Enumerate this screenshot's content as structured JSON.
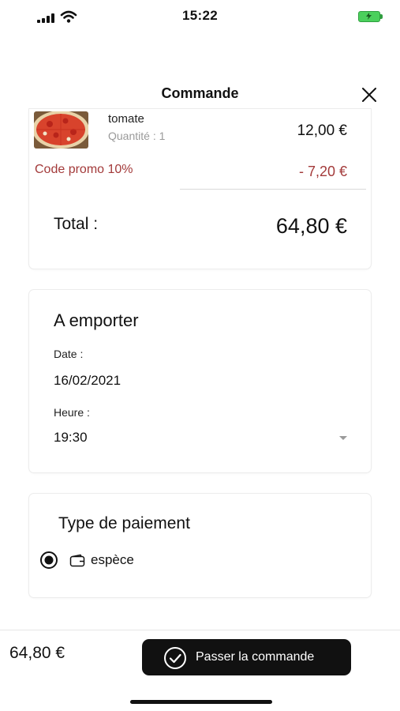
{
  "status_bar": {
    "time": "15:22"
  },
  "header": {
    "title": "Commande",
    "close_icon": "close-icon"
  },
  "order": {
    "item_name": "tomate",
    "item_quantity": "Quantité : 1",
    "item_price": "12,00 €",
    "promo_label": "Code promo 10%",
    "promo_value": "- 7,20 €",
    "total_label": "Total :",
    "total_value": "64,80 €"
  },
  "takeaway": {
    "title": "A emporter",
    "date_label": "Date :",
    "date_value": "16/02/2021",
    "time_label": "Heure :",
    "time_value": "19:30"
  },
  "payment": {
    "title": "Type de paiement",
    "option_label": "espèce",
    "option_selected": true
  },
  "footer": {
    "total": "64,80 €",
    "order_button": "Passer la commande"
  },
  "colors": {
    "accent": "#111111",
    "promo": "#a33a3a",
    "battery": "#4bd05c"
  }
}
